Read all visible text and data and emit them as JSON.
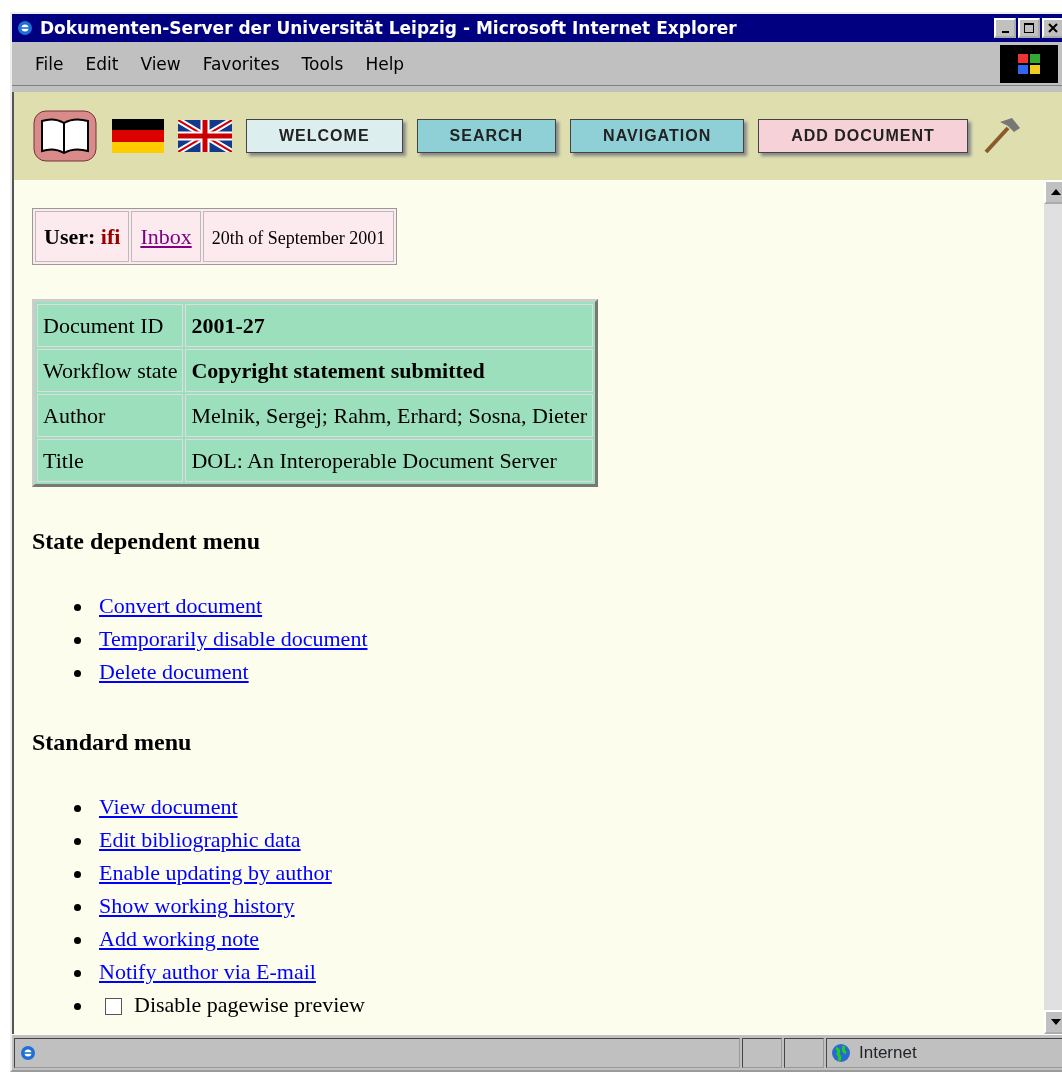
{
  "window": {
    "title": "Dokumenten-Server der Universität Leipzig - Microsoft Internet Explorer"
  },
  "menu_bar": [
    "File",
    "Edit",
    "View",
    "Favorites",
    "Tools",
    "Help"
  ],
  "nav_buttons": [
    {
      "label": "WELCOME",
      "color": "#dcefee"
    },
    {
      "label": "SEARCH",
      "color": "#8fcfd6"
    },
    {
      "label": "NAVIGATION",
      "color": "#8fcfd6"
    },
    {
      "label": "ADD DOCUMENT",
      "color": "#f6d2d8"
    }
  ],
  "user_bar": {
    "user_label": "User:",
    "user": "ifi",
    "inbox": "Inbox",
    "date": "20th of September 2001"
  },
  "document": [
    {
      "label": "Document ID",
      "value": "2001-27",
      "bold": true
    },
    {
      "label": "Workflow state",
      "value": "Copyright statement submitted",
      "bold": true
    },
    {
      "label": "Author",
      "value": "Melnik, Sergej; Rahm, Erhard; Sosna, Dieter",
      "bold": false
    },
    {
      "label": "Title",
      "value": "DOL: An Interoperable Document Server",
      "bold": false
    }
  ],
  "sections": [
    {
      "heading": "State dependent menu",
      "items": [
        {
          "kind": "link",
          "label": "Convert document"
        },
        {
          "kind": "link",
          "label": "Temporarily disable document"
        },
        {
          "kind": "link",
          "label": "Delete document"
        }
      ]
    },
    {
      "heading": "Standard menu",
      "items": [
        {
          "kind": "link",
          "label": "View document"
        },
        {
          "kind": "link",
          "label": "Edit bibliographic data"
        },
        {
          "kind": "link",
          "label": "Enable updating by author"
        },
        {
          "kind": "link",
          "label": "Show working history"
        },
        {
          "kind": "link",
          "label": "Add working note"
        },
        {
          "kind": "link",
          "label": "Notify author via E-mail"
        },
        {
          "kind": "checkbox",
          "label": "Disable pagewise preview",
          "checked": false
        }
      ]
    }
  ],
  "status_bar": {
    "zone": "Internet"
  }
}
